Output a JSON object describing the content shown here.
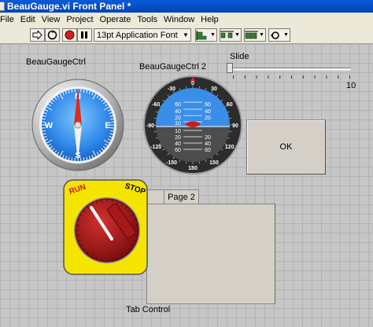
{
  "window": {
    "title": "BeauGauge.vi Front Panel *"
  },
  "menu": [
    "File",
    "Edit",
    "View",
    "Project",
    "Operate",
    "Tools",
    "Window",
    "Help"
  ],
  "toolbar": {
    "font_label": "13pt Application Font"
  },
  "controls": {
    "compass_label": "BeauGaugeCtrl",
    "horizon_label": "BeauGaugeCtrl 2",
    "slide_label": "Slide",
    "slide_max": "10",
    "slide_value": 0,
    "ok_label": "OK",
    "tab_control_label": "Tab Control",
    "tab_page_label": "Page 2"
  },
  "compass": {
    "letters": [
      "N",
      "E",
      "S",
      "W"
    ]
  },
  "horizon": {
    "top_ticks": [
      "60",
      "40",
      "20",
      "10",
      "0"
    ],
    "bottom_ticks": [
      "10",
      "20",
      "40",
      "60"
    ],
    "bezel": [
      "0",
      "30",
      "60",
      "90",
      "120",
      "150",
      "180",
      "-30",
      "-60",
      "-90",
      "-120",
      "-150"
    ]
  },
  "knob": {
    "run_label": "RUN",
    "stop_label": "STOP"
  },
  "colors": {
    "title_bar": "#0a5bd8",
    "sky": "#3a8ee8",
    "ground": "#4d4d4d",
    "knob_red": "#a21818",
    "knob_plate": "#f5e400"
  }
}
